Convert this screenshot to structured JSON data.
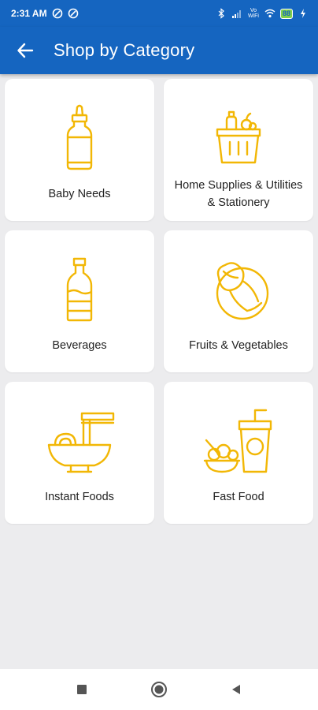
{
  "status_bar": {
    "time": "2:31 AM",
    "network_label": "Vo WiFi",
    "battery_level": "88"
  },
  "app_bar": {
    "title": "Shop by Category"
  },
  "categories": [
    {
      "label": "Baby Needs",
      "icon": "baby-bottle-icon"
    },
    {
      "label": "Home Supplies & Utilities & Stationery",
      "icon": "basket-icon"
    },
    {
      "label": "Beverages",
      "icon": "bottle-icon"
    },
    {
      "label": "Fruits & Vegetables",
      "icon": "cabbage-icon"
    },
    {
      "label": "Instant Foods",
      "icon": "noodle-bowl-icon"
    },
    {
      "label": "Fast Food",
      "icon": "fast-food-icon"
    }
  ],
  "colors": {
    "primary": "#1565c0",
    "icon_gold": "#f2b705",
    "background": "#ececee"
  },
  "nav_bar": {
    "items": [
      "recents-button",
      "home-button",
      "back-button"
    ]
  }
}
